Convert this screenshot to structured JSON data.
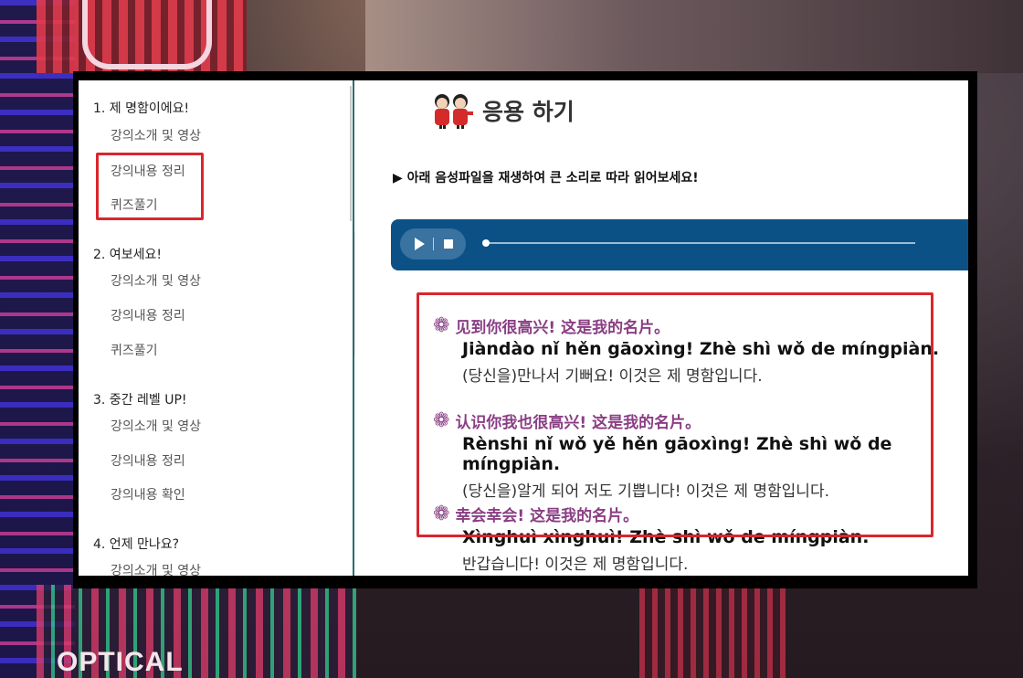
{
  "sidebar": {
    "chapters": [
      {
        "label": "1. 제 명함이에요!",
        "items": [
          "강의소개 및 영상",
          "강의내용 정리",
          "퀴즈풀기"
        ]
      },
      {
        "label": "2. 여보세요!",
        "items": [
          "강의소개 및 영상",
          "강의내용 정리",
          "퀴즈풀기"
        ]
      },
      {
        "label": "3. 중간 레벨 UP!",
        "items": [
          "강의소개 및 영상",
          "강의내용 정리",
          "강의내용 확인"
        ]
      },
      {
        "label": "4. 언제 만나요?",
        "items": [
          "강의소개 및 영상"
        ]
      }
    ]
  },
  "main": {
    "title": "응용 하기",
    "instruction": "▶ 아래 음성파일을 재생하여 큰 소리로 따라 읽어보세요!",
    "entries": [
      {
        "chinese": "见到你很高兴! 这是我的名片。",
        "pinyin": "Jiàndào nǐ hěn gāoxìng! Zhè shì wǒ de míngpiàn.",
        "korean": "(당신을)만나서 기뻐요! 이것은 제 명함입니다."
      },
      {
        "chinese": "认识你我也很高兴! 这是我的名片。",
        "pinyin": "Rènshi nǐ wǒ yě hěn gāoxìng! Zhè shì wǒ de míngpiàn.",
        "korean": "(당신을)알게 되어 저도 기쁩니다! 이것은 제 명함입니다."
      },
      {
        "chinese": "幸会幸会! 这是我的名片。",
        "pinyin": "Xìnghuì xìnghuì! Zhè shì wǒ de míngpiàn.",
        "korean": "반갑습니다! 이것은 제 명함입니다."
      }
    ]
  },
  "background": {
    "sign_text": "OPTICAL"
  },
  "colors": {
    "accent": "#0b5186",
    "highlight": "#d9262e",
    "chinese_text": "#8a3e84",
    "sidebar_border": "#2d6b70"
  }
}
